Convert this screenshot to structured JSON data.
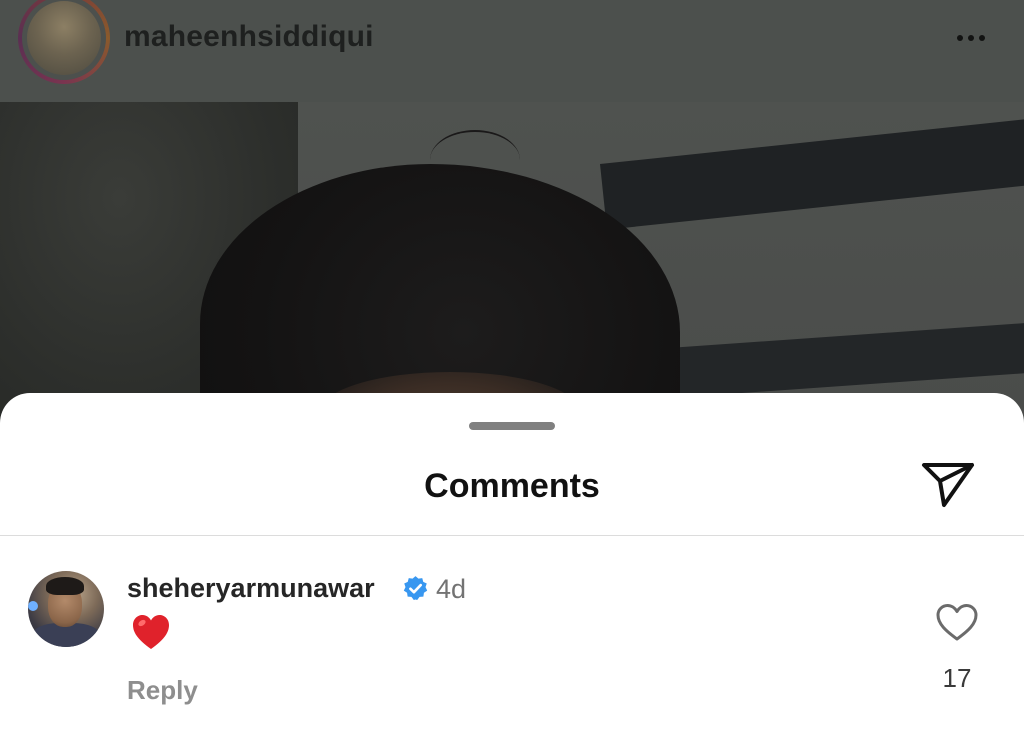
{
  "post": {
    "username": "maheenhsiddiqui",
    "avatar_icon": "profile-avatar",
    "more_icon": "more-horizontal-icon"
  },
  "comments_sheet": {
    "title": "Comments",
    "share_icon": "send-icon"
  },
  "comments": [
    {
      "username": "sheheryarmunawar",
      "verified": true,
      "time": "4d",
      "text": "❤️",
      "reply_label": "Reply",
      "like_count": "17",
      "like_icon": "heart-outline-icon"
    }
  ],
  "colors": {
    "verified_blue": "#3897f0",
    "heart_red": "#e0222b"
  }
}
